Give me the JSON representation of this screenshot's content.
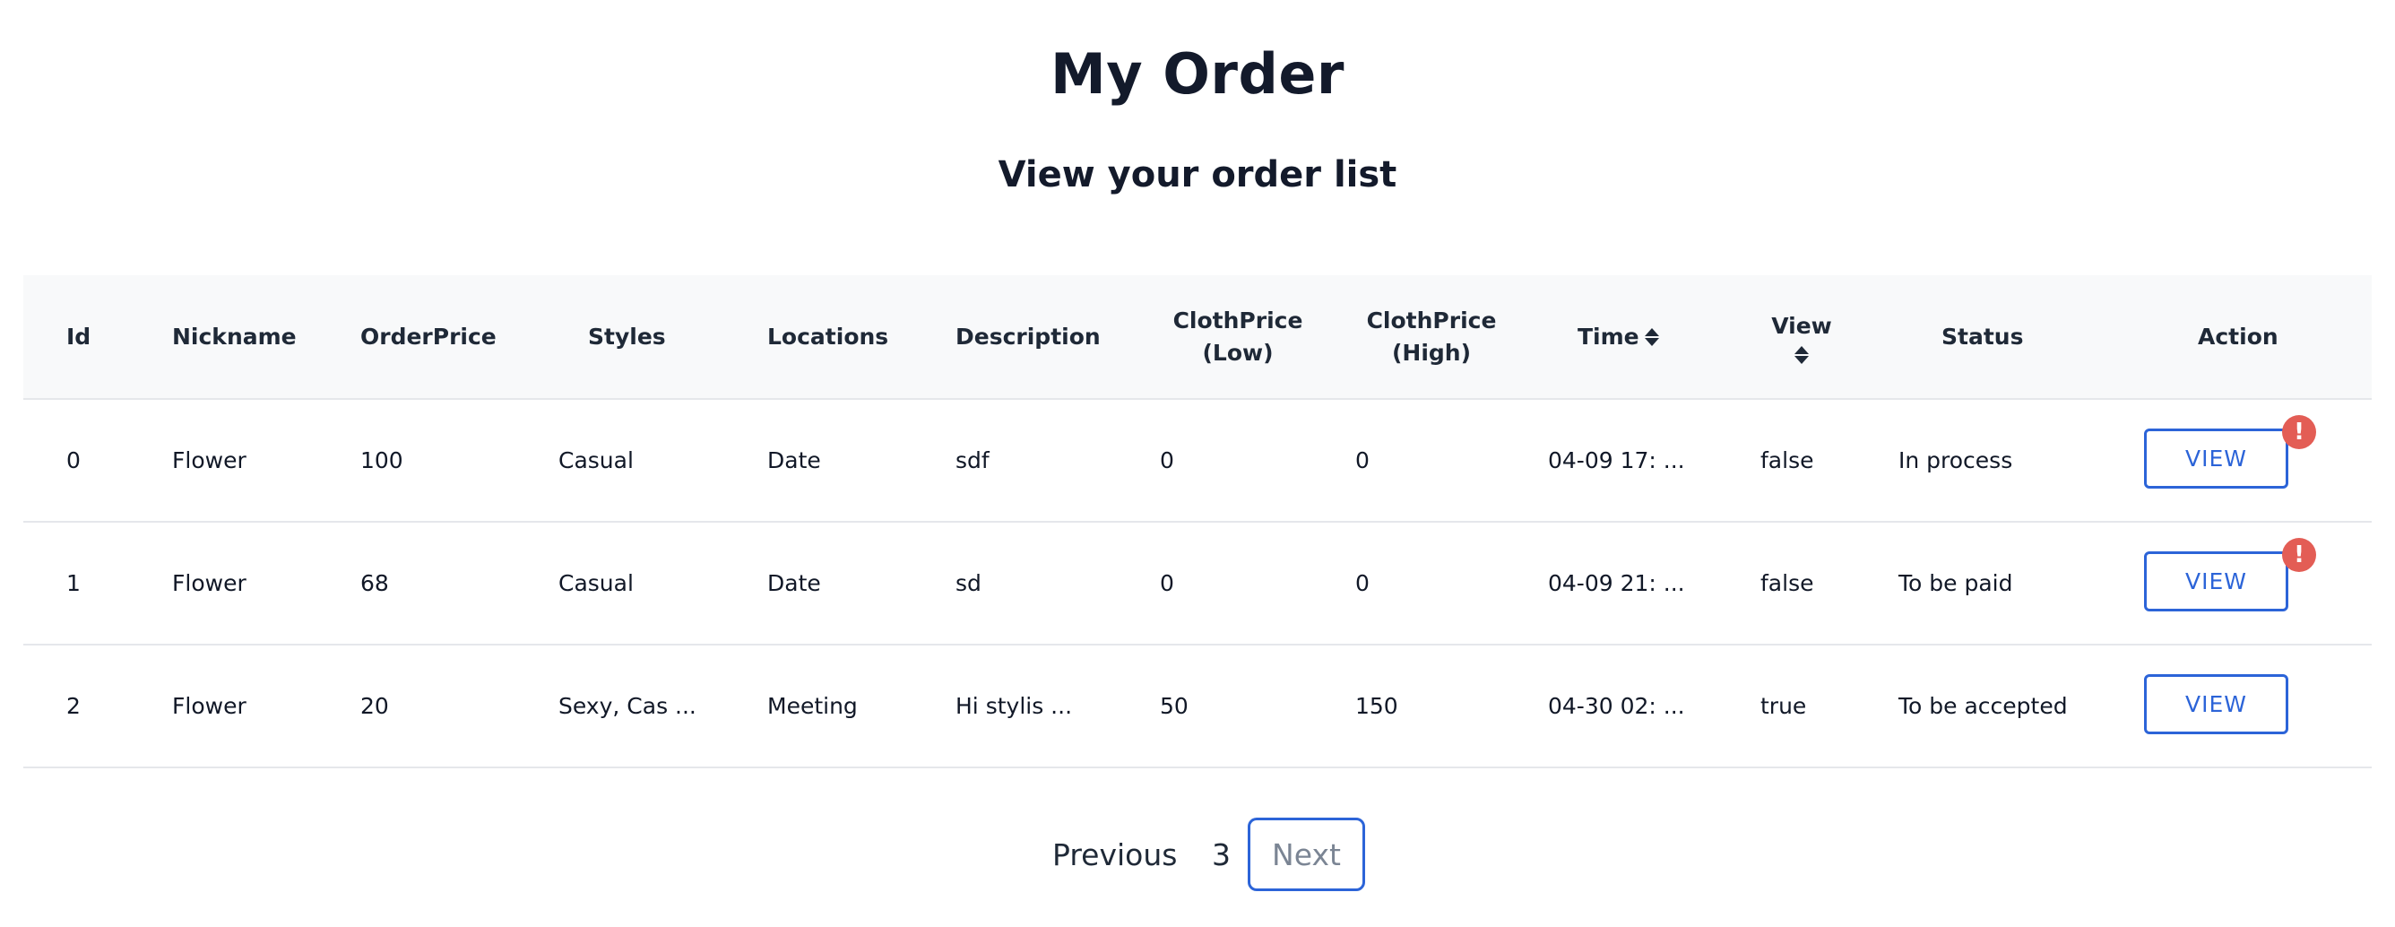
{
  "header": {
    "title": "My Order",
    "subtitle": "View your order list"
  },
  "table": {
    "columns": {
      "id": "Id",
      "nickname": "Nickname",
      "order_price": "OrderPrice",
      "styles": "Styles",
      "locations": "Locations",
      "description": "Description",
      "cloth_low_1": "ClothPrice",
      "cloth_low_2": "(Low)",
      "cloth_high_1": "ClothPrice",
      "cloth_high_2": "(High)",
      "time": "Time",
      "view": "View",
      "status": "Status",
      "action": "Action"
    },
    "rows": [
      {
        "id": "0",
        "nickname": "Flower",
        "order_price": "100",
        "styles": "Casual",
        "locations": "Date",
        "description": "sdf",
        "cloth_low": "0",
        "cloth_high": "0",
        "time": "04-09 17: ...",
        "view": "false",
        "status": "In process",
        "action_label": "VIEW",
        "alert": "!"
      },
      {
        "id": "1",
        "nickname": "Flower",
        "order_price": "68",
        "styles": "Casual",
        "locations": "Date",
        "description": "sd",
        "cloth_low": "0",
        "cloth_high": "0",
        "time": "04-09 21: ...",
        "view": "false",
        "status": "To be paid",
        "action_label": "VIEW",
        "alert": "!"
      },
      {
        "id": "2",
        "nickname": "Flower",
        "order_price": "20",
        "styles": "Sexy, Cas ...",
        "locations": "Meeting",
        "description": "Hi stylis ...",
        "cloth_low": "50",
        "cloth_high": "150",
        "time": "04-30 02: ...",
        "view": "true",
        "status": "To be accepted",
        "action_label": "VIEW"
      }
    ]
  },
  "pagination": {
    "previous_label": "Previous",
    "current_page": "3",
    "next_label": "Next"
  },
  "colors": {
    "accent": "#2c64d8",
    "alert": "#e35d55",
    "header_bg": "#f8f9fa"
  }
}
